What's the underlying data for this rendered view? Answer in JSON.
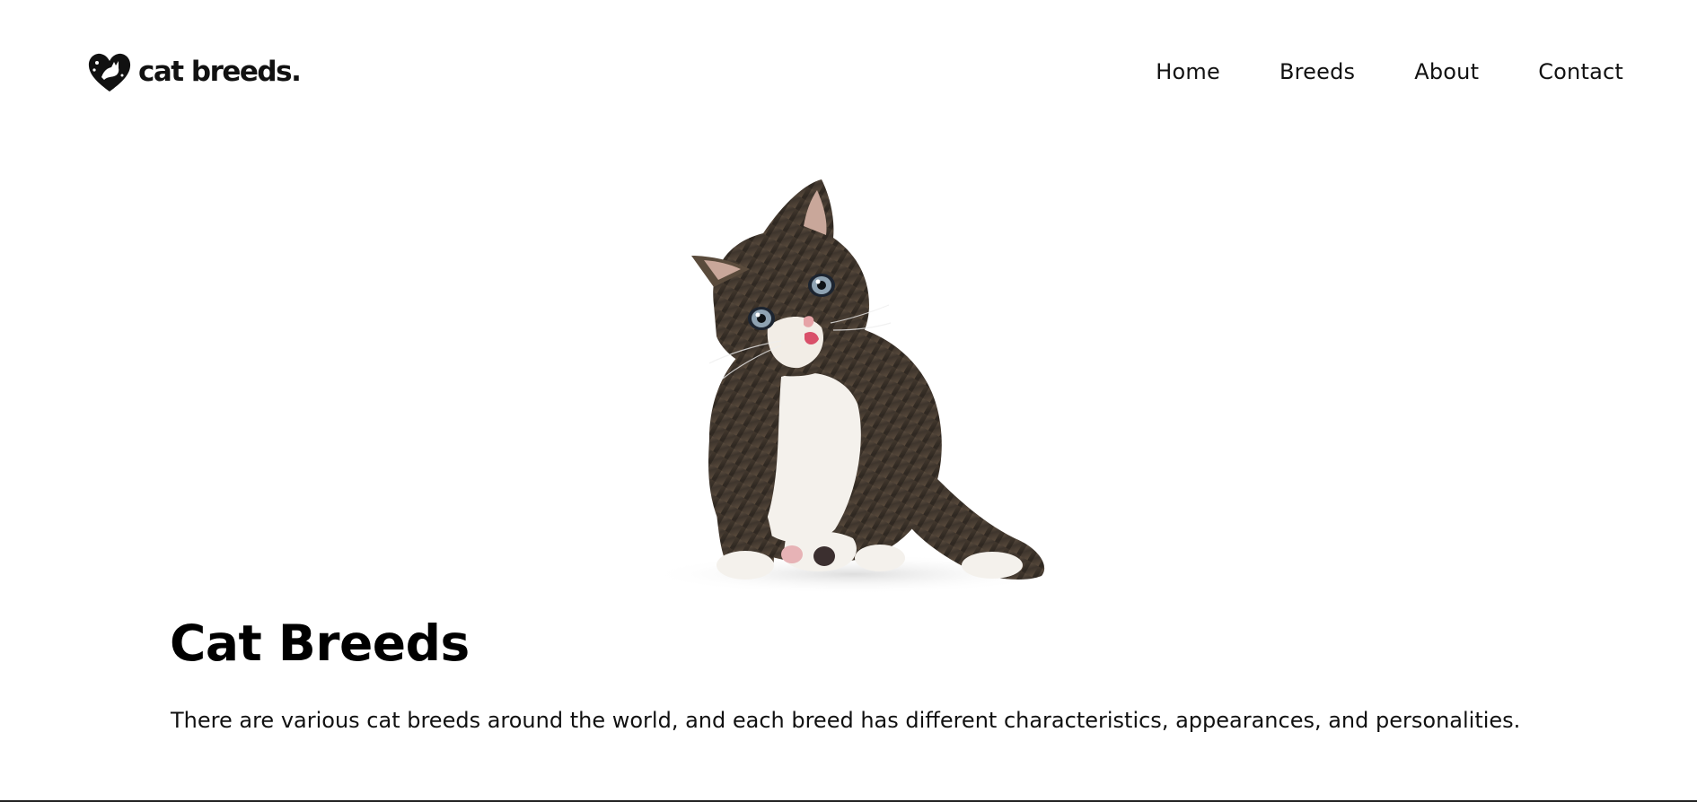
{
  "header": {
    "logo_text": "cat breeds.",
    "logo_icon": "heart-cat-icon",
    "nav": [
      {
        "label": "Home"
      },
      {
        "label": "Breeds"
      },
      {
        "label": "About"
      },
      {
        "label": "Contact"
      }
    ]
  },
  "hero": {
    "image": "tabby-kitten-image"
  },
  "main": {
    "title": "Cat Breeds",
    "description": "There are various cat breeds around the world, and each breed has different characteristics, appearances, and personalities."
  },
  "colors": {
    "background": "#ffffff",
    "text": "#111111"
  }
}
